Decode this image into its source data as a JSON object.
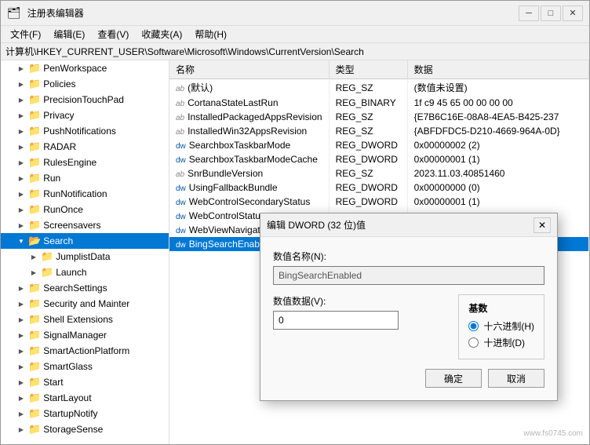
{
  "window": {
    "title": "注册表编辑器",
    "controls": {
      "minimize": "─",
      "maximize": "□",
      "close": "✕"
    }
  },
  "menubar": {
    "items": [
      {
        "label": "文件(F)"
      },
      {
        "label": "编辑(E)"
      },
      {
        "label": "查看(V)"
      },
      {
        "label": "收藏夹(A)"
      },
      {
        "label": "帮助(H)"
      }
    ]
  },
  "address": {
    "path": "计算机\\HKEY_CURRENT_USER\\Software\\Microsoft\\Windows\\CurrentVersion\\Search"
  },
  "tree": {
    "items": [
      {
        "label": "PenWorkspace",
        "level": 1,
        "expanded": false,
        "folder": true
      },
      {
        "label": "Policies",
        "level": 1,
        "expanded": false,
        "folder": true
      },
      {
        "label": "PrecisionTouchPad",
        "level": 1,
        "expanded": false,
        "folder": true
      },
      {
        "label": "Privacy",
        "level": 1,
        "expanded": false,
        "folder": true
      },
      {
        "label": "PushNotifications",
        "level": 1,
        "expanded": false,
        "folder": true
      },
      {
        "label": "RADAR",
        "level": 1,
        "expanded": false,
        "folder": true
      },
      {
        "label": "RulesEngine",
        "level": 1,
        "expanded": false,
        "folder": true
      },
      {
        "label": "Run",
        "level": 1,
        "expanded": false,
        "folder": true
      },
      {
        "label": "RunNotification",
        "level": 1,
        "expanded": false,
        "folder": true
      },
      {
        "label": "RunOnce",
        "level": 1,
        "expanded": false,
        "folder": true
      },
      {
        "label": "Screensavers",
        "level": 1,
        "expanded": false,
        "folder": true
      },
      {
        "label": "Search",
        "level": 1,
        "expanded": true,
        "folder": true,
        "selected": true
      },
      {
        "label": "JumplistData",
        "level": 2,
        "expanded": false,
        "folder": true
      },
      {
        "label": "Launch",
        "level": 2,
        "expanded": false,
        "folder": true
      },
      {
        "label": "SearchSettings",
        "level": 1,
        "expanded": false,
        "folder": true
      },
      {
        "label": "Security and Mainter",
        "level": 1,
        "expanded": false,
        "folder": true
      },
      {
        "label": "Shell Extensions",
        "level": 1,
        "expanded": false,
        "folder": true
      },
      {
        "label": "SignalManager",
        "level": 1,
        "expanded": false,
        "folder": true
      },
      {
        "label": "SmartActionPlatform",
        "level": 1,
        "expanded": false,
        "folder": true
      },
      {
        "label": "SmartGlass",
        "level": 1,
        "expanded": false,
        "folder": true
      },
      {
        "label": "Start",
        "level": 1,
        "expanded": false,
        "folder": true
      },
      {
        "label": "StartLayout",
        "level": 1,
        "expanded": false,
        "folder": true
      },
      {
        "label": "StartupNotify",
        "level": 1,
        "expanded": false,
        "folder": true
      },
      {
        "label": "StorageSense",
        "level": 1,
        "expanded": false,
        "folder": true
      }
    ]
  },
  "registry": {
    "columns": [
      {
        "label": "名称"
      },
      {
        "label": "类型"
      },
      {
        "label": "数据"
      }
    ],
    "entries": [
      {
        "name": "(默认)",
        "type": "REG_SZ",
        "data": "(数值未设置)",
        "icon": "ab"
      },
      {
        "name": "CortanaStateLastRun",
        "type": "REG_BINARY",
        "data": "1f c9 45 65 00 00 00 00",
        "icon": "ab"
      },
      {
        "name": "InstalledPackagedAppsRevision",
        "type": "REG_SZ",
        "data": "{E7B6C16E-08A8-4EA5-B425-237",
        "icon": "ab"
      },
      {
        "name": "InstalledWin32AppsRevision",
        "type": "REG_SZ",
        "data": "{ABFDFDC5-D210-4669-964A-0D}",
        "icon": "ab"
      },
      {
        "name": "SearchboxTaskbarMode",
        "type": "REG_DWORD",
        "data": "0x00000002 (2)",
        "icon": "dw"
      },
      {
        "name": "SearchboxTaskbarModeCache",
        "type": "REG_DWORD",
        "data": "0x00000001 (1)",
        "icon": "dw"
      },
      {
        "name": "SnrBundleVersion",
        "type": "REG_SZ",
        "data": "2023.11.03.40851460",
        "icon": "ab"
      },
      {
        "name": "UsingFallbackBundle",
        "type": "REG_DWORD",
        "data": "0x00000000 (0)",
        "icon": "dw"
      },
      {
        "name": "WebControlSecondaryStatus",
        "type": "REG_DWORD",
        "data": "0x00000001 (1)",
        "icon": "dw"
      },
      {
        "name": "WebControlStatus",
        "type": "REG_DWORD",
        "data": "",
        "icon": "dw"
      },
      {
        "name": "WebViewNavigation...",
        "type": "REG_DWORD",
        "data": "",
        "icon": "dw"
      },
      {
        "name": "BingSearchEnabled",
        "type": "REG_DWORD",
        "data": "",
        "icon": "dw",
        "selected": true
      }
    ]
  },
  "dialog": {
    "title": "编辑 DWORD (32 位)值",
    "close_btn": "✕",
    "name_label": "数值名称(N):",
    "name_value": "BingSearchEnabled",
    "data_label": "数值数据(V):",
    "data_value": "0",
    "base_label": "基数",
    "radios": [
      {
        "label": "十六进制(H)",
        "checked": true
      },
      {
        "label": "十进制(D)",
        "checked": false
      }
    ],
    "ok_label": "确定",
    "cancel_label": "取消"
  },
  "watermark": {
    "text": "www.fs0745.com"
  }
}
